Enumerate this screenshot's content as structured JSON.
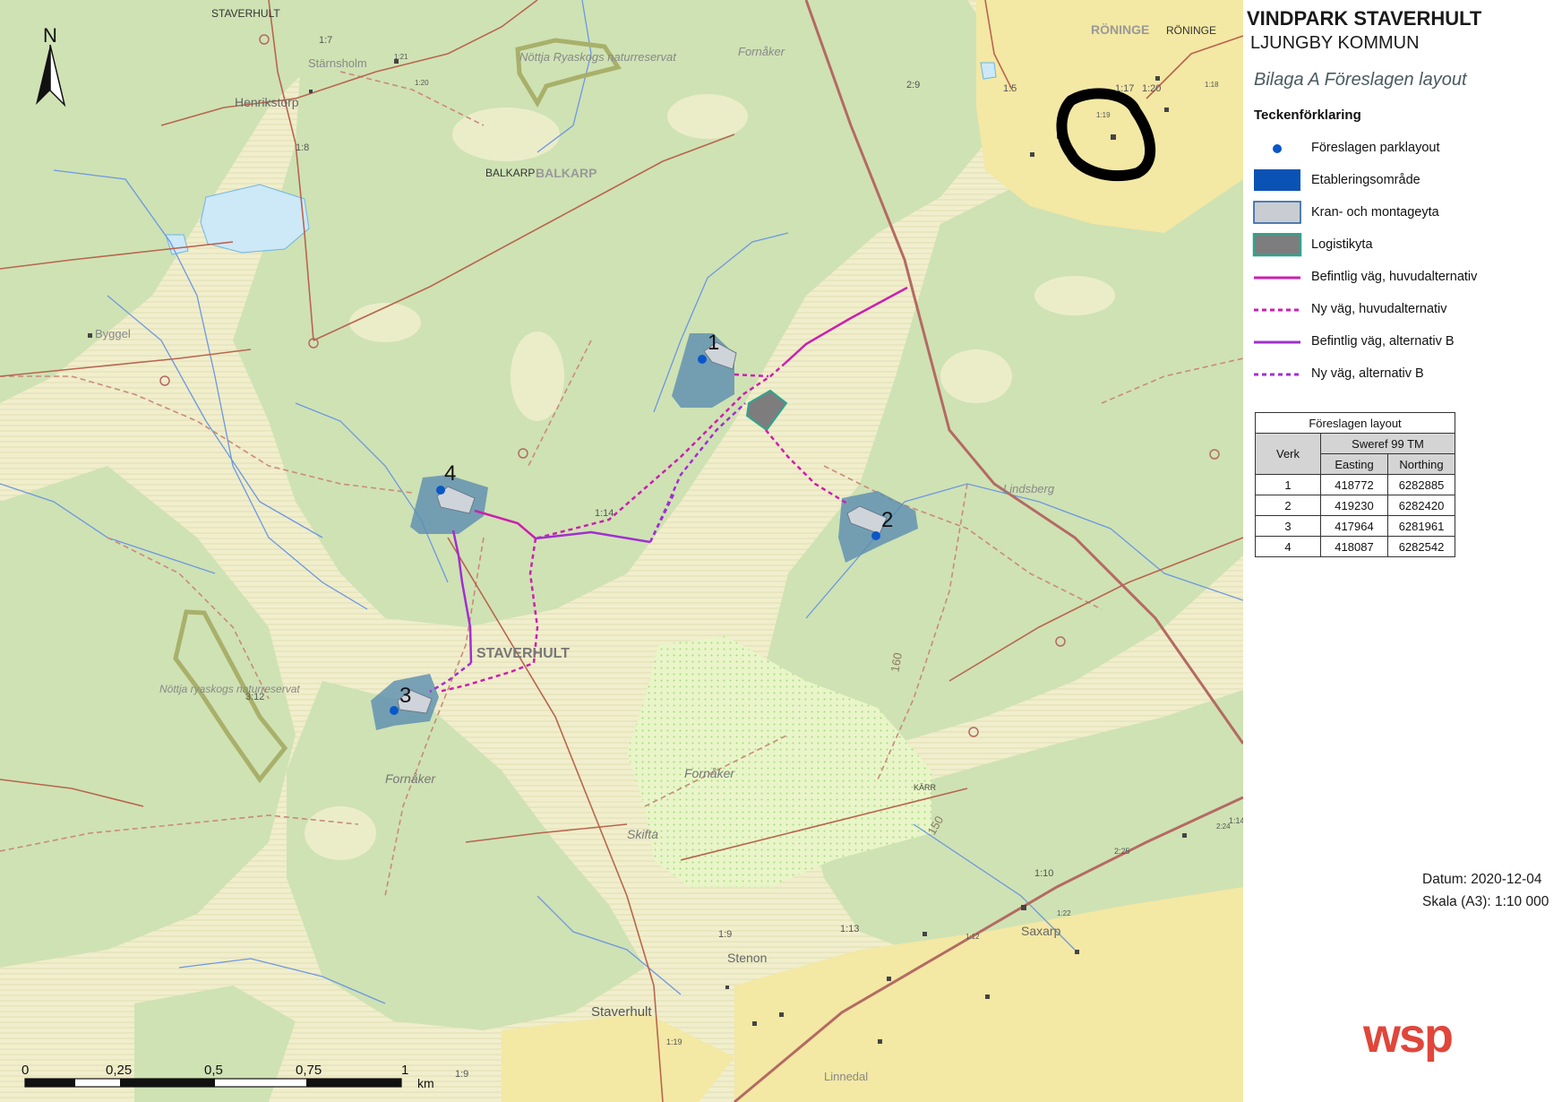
{
  "header": {
    "title": "VINDPARK STAVERHULT",
    "subtitle": "LJUNGBY KOMMUN",
    "appendix": "Bilaga A Föreslagen layout"
  },
  "legend": {
    "title": "Teckenförklaring",
    "items": [
      {
        "label": "Föreslagen parklayout",
        "symbol": "dot",
        "color": "#0b57c8"
      },
      {
        "label": "Etableringsområde",
        "symbol": "fill",
        "color": "#0a53b5"
      },
      {
        "label": "Kran- och montageyta",
        "symbol": "fill-outline",
        "color": "#c9cdd2"
      },
      {
        "label": "Logistikyta",
        "symbol": "fill-outline-green",
        "color": "#7d7d7d"
      },
      {
        "label": "Befintlig väg, huvudalternativ",
        "symbol": "line",
        "color": "#cc1fae"
      },
      {
        "label": "Ny väg, huvudalternativ",
        "symbol": "dashed",
        "color": "#cc1fae"
      },
      {
        "label": "Befintlig väg, alternativ B",
        "symbol": "line",
        "color": "#a12fd1"
      },
      {
        "label": "Ny väg, alternativ B",
        "symbol": "dashed",
        "color": "#a12fd1"
      }
    ]
  },
  "table": {
    "title": "Föreslagen layout",
    "crs": "Sweref 99 TM",
    "col_verk": "Verk",
    "col_easting": "Easting",
    "col_northing": "Northing",
    "rows": [
      {
        "verk": "1",
        "easting": "418772",
        "northing": "6282885"
      },
      {
        "verk": "2",
        "easting": "419230",
        "northing": "6282420"
      },
      {
        "verk": "3",
        "easting": "417964",
        "northing": "6281961"
      },
      {
        "verk": "4",
        "easting": "418087",
        "northing": "6282542"
      }
    ]
  },
  "meta": {
    "datum": "Datum: 2020-12-04",
    "skala": "Skala (A3): 1:10 000"
  },
  "logo": "wsp",
  "north_arrow": "N",
  "scalebar": {
    "ticks": [
      "0",
      "0,25",
      "0,5",
      "0,75",
      "1"
    ],
    "unit": "km"
  },
  "map": {
    "turbine_labels": [
      "1",
      "2",
      "3",
      "4"
    ],
    "place_labels": {
      "staverhult_top": "STAVERHULT",
      "staverhult_mid": "STAVERHULT",
      "staverhult_bottom": "Staverhult",
      "balkarp": "BALKARP",
      "balkarp_map": "BALKARP",
      "roninge": "RÖNINGE",
      "roninge_map": "RÖNINGE",
      "henrikstorp": "Henrikstorp",
      "byggel": "Byggel",
      "nottja_north": "Nöttja Ryaskogs naturreservat",
      "nottja_south": "Nöttja ryaskogs naturreservat",
      "fornaker_top": "Fornåker",
      "fornaker_left": "Fornåker",
      "fornaker_mid": "Fornåker",
      "skifta": "Skifta",
      "stenon": "Stenon",
      "saxarp": "Saxarp",
      "lindsberg": "Lindsberg",
      "linnedal": "Linnedal",
      "starnsholm": "Stärnsholm",
      "karr": "KÄRR"
    },
    "contour_labels": [
      "160",
      "150"
    ],
    "misc_labels": [
      "1:7",
      "1:21",
      "1:20",
      "1:8",
      "2:9",
      "1:5",
      "1:17",
      "1:19",
      "1:20",
      "1:18",
      "1:14",
      "1:10",
      "1:13",
      "1:9",
      "1:19",
      "1:9",
      "3:12",
      "2:25",
      "1:14",
      "1:12",
      "1:22",
      "2:24"
    ]
  }
}
